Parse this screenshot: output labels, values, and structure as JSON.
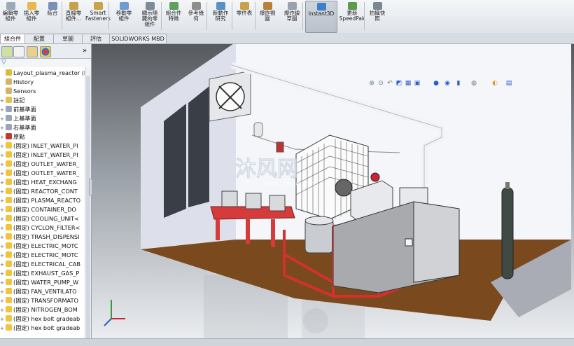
{
  "ribbon": {
    "buttons": [
      {
        "label": "插入零\n組件",
        "icon": "insert-component-icon",
        "color": "#e9b84a"
      },
      {
        "label": "結合",
        "icon": "mate-icon",
        "color": "#7a8fb5"
      },
      {
        "label": "直線零\n組件...",
        "icon": "linear-pattern-icon",
        "color": "#c7a04e"
      },
      {
        "label": "Smart\nFasteners",
        "icon": "smart-fasteners-icon",
        "color": "#c9a24a"
      },
      {
        "label": "移動零\n組件",
        "icon": "move-component-icon",
        "color": "#6f9bd0"
      },
      {
        "label": "顯示隱\n藏的零\n組件",
        "icon": "show-hidden-icon",
        "color": "#7f8a99"
      },
      {
        "label": "組合件\n特徵",
        "icon": "assembly-features-icon",
        "color": "#5f9f5f"
      },
      {
        "label": "參考幾\n何",
        "icon": "reference-geometry-icon",
        "color": "#8e8e8e"
      },
      {
        "label": "新動作\n研究",
        "icon": "motion-study-icon",
        "color": "#5a8fc7"
      },
      {
        "label": "零件表",
        "icon": "bom-icon",
        "color": "#c9a04a"
      },
      {
        "label": "爆炸視\n圖",
        "icon": "exploded-view-icon",
        "color": "#b8813a"
      },
      {
        "label": "爆炸線\n草圖",
        "icon": "explode-line-icon",
        "color": "#9aa3ad"
      },
      {
        "label": "Instant3D",
        "icon": "instant3d-icon",
        "color": "#3f7fc9"
      },
      {
        "label": "更新\nSpeedPak",
        "icon": "speedpak-icon",
        "color": "#5b9b4b"
      },
      {
        "label": "拍攝快\n照",
        "icon": "snapshot-icon",
        "color": "#7c8794"
      }
    ],
    "partial_left_label": "編輯零\n組件"
  },
  "tabs": [
    "組合件",
    "配置",
    "草圖",
    "評估",
    "SOLIDWORKS MBD"
  ],
  "panel": {
    "tree_items": [
      {
        "label": "Layout_plasma_reactor  (De",
        "icon": "assembly-icon",
        "color": "#e0b83a"
      },
      {
        "label": "History",
        "icon": "history-icon",
        "color": "#d4b463"
      },
      {
        "label": "Sensors",
        "icon": "sensors-icon",
        "color": "#d4b463"
      },
      {
        "label": "註記",
        "icon": "annotations-icon",
        "color": "#e3c24d"
      },
      {
        "label": "前基準面",
        "icon": "plane-icon",
        "color": "#9aa6b6"
      },
      {
        "label": "上基準面",
        "icon": "plane-icon",
        "color": "#9aa6b6"
      },
      {
        "label": "右基準面",
        "icon": "plane-icon",
        "color": "#9aa6b6"
      },
      {
        "label": "原點",
        "icon": "origin-icon",
        "color": "#c0392b"
      },
      {
        "label": "(固定) INLET_WATER_PI",
        "icon": "subassembly-icon",
        "color": "#f0c43b"
      },
      {
        "label": "(固定) INLET_WATER_PI",
        "icon": "subassembly-icon",
        "color": "#f0c43b"
      },
      {
        "label": "(固定) OUTLET_WATER_",
        "icon": "subassembly-icon",
        "color": "#f0c43b"
      },
      {
        "label": "(固定) OUTLET_WATER_",
        "icon": "subassembly-icon",
        "color": "#f0c43b"
      },
      {
        "label": "(固定) HEAT_EXCHANG",
        "icon": "subassembly-icon",
        "color": "#f0c43b"
      },
      {
        "label": "(固定) REACTOR_CONT",
        "icon": "subassembly-icon",
        "color": "#f0c43b"
      },
      {
        "label": "(固定) PLASMA_REACTO",
        "icon": "subassembly-icon",
        "color": "#f0c43b"
      },
      {
        "label": "(固定) CONTAINER_DO",
        "icon": "subassembly-icon",
        "color": "#f0c43b"
      },
      {
        "label": "(固定) COOLING_UNIT<",
        "icon": "subassembly-icon",
        "color": "#f0c43b"
      },
      {
        "label": "(固定) CYCLON_FILTER<",
        "icon": "subassembly-icon",
        "color": "#f0c43b"
      },
      {
        "label": "(固定) TRASH_DISPENSI",
        "icon": "subassembly-icon",
        "color": "#f0c43b"
      },
      {
        "label": "(固定) ELECTRIC_MOTC",
        "icon": "subassembly-icon",
        "color": "#f0c43b"
      },
      {
        "label": "(固定) ELECTRIC_MOTC",
        "icon": "subassembly-icon",
        "color": "#f0c43b"
      },
      {
        "label": "(固定) ELECTRICAL_CAB",
        "icon": "subassembly-icon",
        "color": "#f0c43b"
      },
      {
        "label": "(固定) EXHAUST_GAS_P",
        "icon": "subassembly-icon",
        "color": "#f0c43b"
      },
      {
        "label": "(固定) WATER_PUMP_W",
        "icon": "subassembly-icon",
        "color": "#f0c43b"
      },
      {
        "label": "(固定) FAN_VENTILATO",
        "icon": "subassembly-icon",
        "color": "#f0c43b"
      },
      {
        "label": "(固定) TRANSFORMATO",
        "icon": "subassembly-icon",
        "color": "#f0c43b"
      },
      {
        "label": "(固定) NITROGEN_BOM",
        "icon": "subassembly-icon",
        "color": "#f0c43b"
      },
      {
        "label": "(固定) hex bolt gradeab",
        "icon": "part-icon",
        "color": "#f0c43b"
      },
      {
        "label": "(固定) hex bolt gradeab",
        "icon": "part-icon",
        "color": "#f0c43b"
      }
    ]
  },
  "viewport": {
    "watermark": "沐风网",
    "watermark_url": "www.mfcad.com"
  },
  "colors": {
    "frame_red": "#d2312e",
    "floor": "#7a4a1e",
    "wall": "#e9ecf4",
    "wall_side": "#c9ccd6",
    "cabinet": "#bfbfbf",
    "accent": "#3f7fc9"
  }
}
